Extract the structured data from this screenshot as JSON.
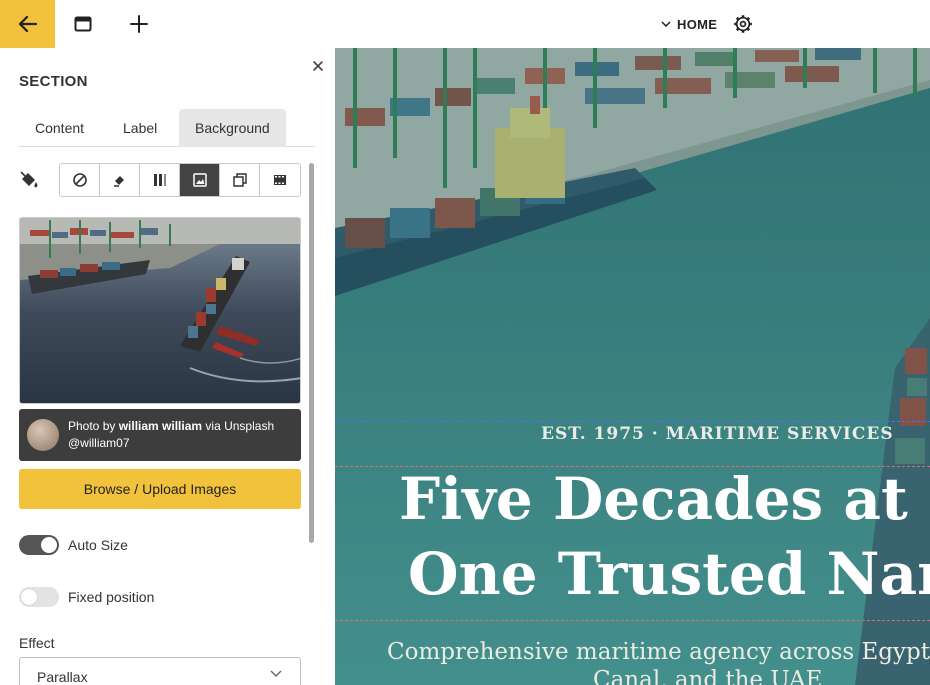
{
  "topbar": {
    "page_name": "HOME"
  },
  "panel": {
    "title": "SECTION",
    "tabs": [
      {
        "label": "Content"
      },
      {
        "label": "Label"
      },
      {
        "label": "Background",
        "active": true
      }
    ],
    "background_types": [
      {
        "icon": "none-icon"
      },
      {
        "icon": "color-fill-icon"
      },
      {
        "icon": "gradient-icon"
      },
      {
        "icon": "image-icon",
        "active": true
      },
      {
        "icon": "slideshow-icon"
      },
      {
        "icon": "video-icon"
      }
    ],
    "credit": {
      "prefix": "Photo by ",
      "author": "william william",
      "suffix": " via Unsplash",
      "handle": "@william07"
    },
    "browse_label": "Browse / Upload Images",
    "auto_size": {
      "label": "Auto Size",
      "on": true
    },
    "fixed_position": {
      "label": "Fixed position",
      "on": false
    },
    "effect": {
      "label": "Effect",
      "value": "Parallax"
    }
  },
  "preview": {
    "eyebrow": "EST. 1975 · MARITIME SERVICES",
    "headline_line1": "Five Decades at Se",
    "headline_line2": "One Trusted Nam",
    "subhead_line1": "Comprehensive maritime agency across Egypt,",
    "subhead_line2": "Canal, and the UAE"
  },
  "colors": {
    "accent": "#f2c23c",
    "panel_dark": "#3d3d3d",
    "sea": "#3f7f80"
  }
}
